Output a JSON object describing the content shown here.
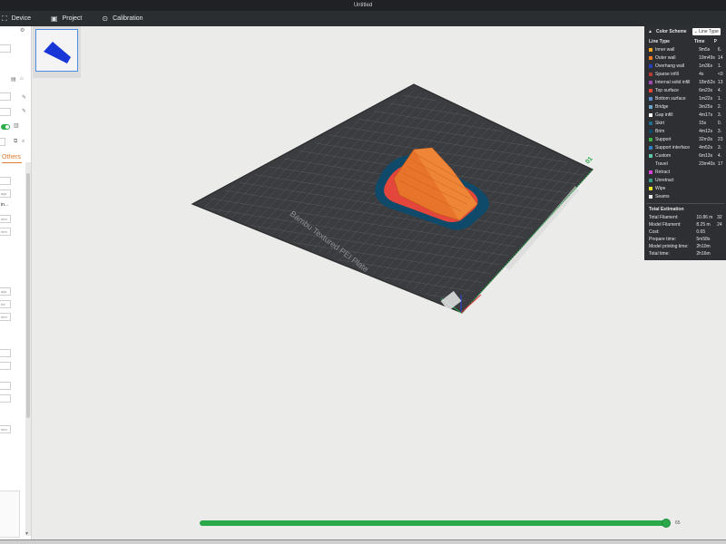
{
  "window": {
    "title": "Untitled"
  },
  "toolbar": {
    "device_icon": "device-icon",
    "device_label": "Device",
    "project_icon": "project-icon",
    "project_label": "Project",
    "calibration_icon": "calibration-icon",
    "calibration_label": "Calibration"
  },
  "sidebar": {
    "tab_active_label": "Others",
    "partial_text": [
      "ays",
      "in...",
      "mm",
      "mm",
      "ays",
      "ed",
      "mm",
      "mm"
    ]
  },
  "plate": {
    "label": "Bambu Textured PEI Plate",
    "number": "01"
  },
  "legend": {
    "title": "Color Scheme",
    "view_mode": "Line Type",
    "columns": [
      "Line Type",
      "Time",
      "P"
    ],
    "rows": [
      {
        "name": "Inner wall",
        "time": "9m5s",
        "pct": "6.",
        "color": "#f5a623"
      },
      {
        "name": "Outer wall",
        "time": "19m49s",
        "pct": "14",
        "color": "#f07a1f"
      },
      {
        "name": "Overhang wall",
        "time": "1m36s",
        "pct": "1.",
        "color": "#2a3dbd"
      },
      {
        "name": "Sparse infill",
        "time": "4s",
        "pct": "<0",
        "color": "#b43a3a"
      },
      {
        "name": "Internal solid infill",
        "time": "18m52s",
        "pct": "13",
        "color": "#a14bb3"
      },
      {
        "name": "Top surface",
        "time": "6m23s",
        "pct": "4.",
        "color": "#e5463c"
      },
      {
        "name": "Bottom surface",
        "time": "1m22s",
        "pct": "1.",
        "color": "#5a8ed1"
      },
      {
        "name": "Bridge",
        "time": "3m25s",
        "pct": "2.",
        "color": "#6aa6c8"
      },
      {
        "name": "Gap infill",
        "time": "4m17s",
        "pct": "3.",
        "color": "#ffffff"
      },
      {
        "name": "Skirt",
        "time": "15s",
        "pct": "0.",
        "color": "#1e6e8c"
      },
      {
        "name": "Brim",
        "time": "4m12s",
        "pct": "3.",
        "color": "#0f4a6b"
      },
      {
        "name": "Support",
        "time": "32m3s",
        "pct": "23",
        "color": "#3bb34a"
      },
      {
        "name": "Support interface",
        "time": "4m52s",
        "pct": "3.",
        "color": "#2f7fbf"
      },
      {
        "name": "Custom",
        "time": "6m13s",
        "pct": "4.",
        "color": "#5ec7a8"
      },
      {
        "name": "Travel",
        "time": "23m40s",
        "pct": "17",
        "color": "#2d2f33"
      },
      {
        "name": "Retract",
        "time": "",
        "pct": "",
        "color": "#d643d6"
      },
      {
        "name": "Unretract",
        "time": "",
        "pct": "",
        "color": "#3a9a8a"
      },
      {
        "name": "Wipe",
        "time": "",
        "pct": "",
        "color": "#e8e82a"
      },
      {
        "name": "Seams",
        "time": "",
        "pct": "",
        "color": "#eaeaea"
      }
    ],
    "total_title": "Total Estimation",
    "totals": [
      {
        "k": "Total Filament:",
        "v": "10.86 m",
        "e": "32"
      },
      {
        "k": "Model Filament:",
        "v": "8.25 m",
        "e": "24"
      },
      {
        "k": "Cost:",
        "v": "0.65",
        "e": ""
      },
      {
        "k": "Prepare time:",
        "v": "5m58s",
        "e": ""
      },
      {
        "k": "Model printing time:",
        "v": "2h10m",
        "e": ""
      },
      {
        "k": "Total time:",
        "v": "2h16m",
        "e": ""
      }
    ]
  },
  "slider": {
    "progress_percent": 100,
    "label": "65"
  },
  "colors": {
    "accent_green": "#2aa84a",
    "orange": "#e07a30",
    "plate_dark": "#3a3c3f",
    "model_orange": "#e8732a",
    "brim_blue": "#0f4a6b"
  }
}
